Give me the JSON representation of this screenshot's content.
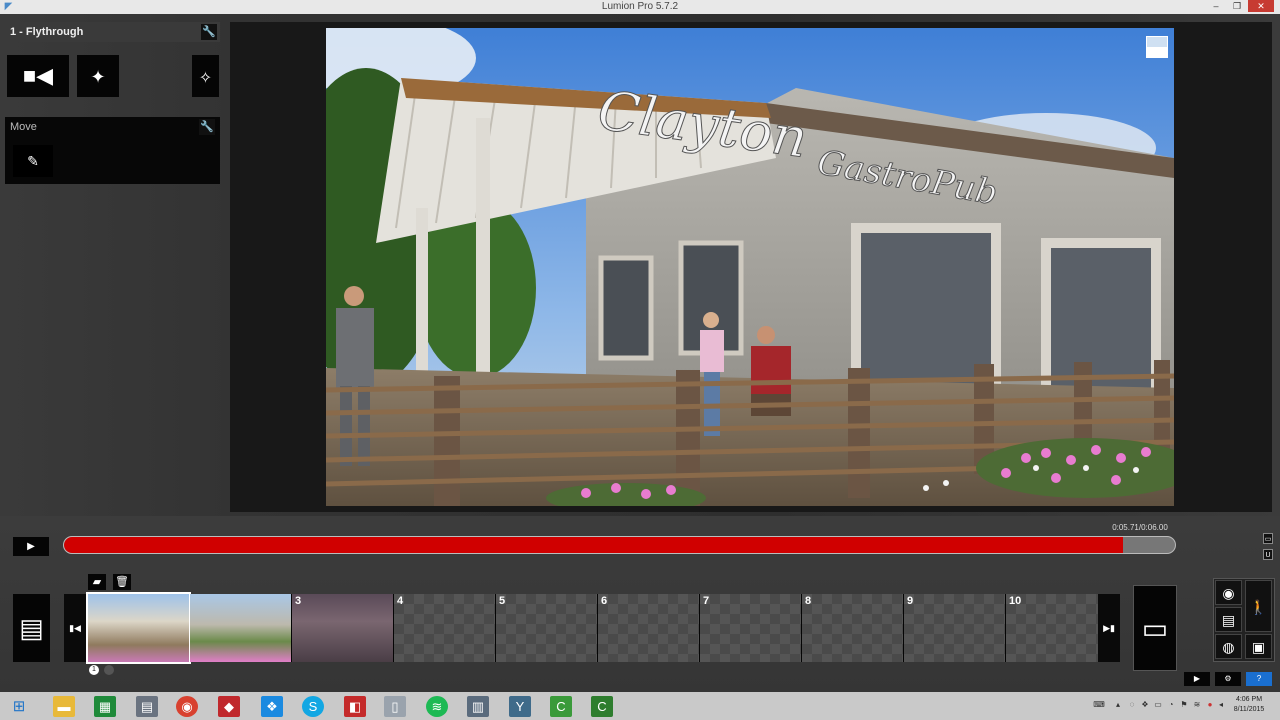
{
  "window": {
    "title": "Lumion Pro 5.7.2"
  },
  "panel": {
    "clip_title": "1 - Flythrough",
    "move_label": "Move"
  },
  "viewport": {
    "sign_line1": "Clayton",
    "sign_line2": "GastroPub"
  },
  "timeline": {
    "time_readout": "0:05.71/0:06.00",
    "progress": 0.953,
    "slots": [
      {
        "num": "",
        "filled": true,
        "scene": "pub-day"
      },
      {
        "num": "",
        "filled": true,
        "scene": "pub-wide"
      },
      {
        "num": "3",
        "filled": true,
        "scene": "pub-sign"
      },
      {
        "num": "4",
        "filled": false
      },
      {
        "num": "5",
        "filled": false
      },
      {
        "num": "6",
        "filled": false
      },
      {
        "num": "7",
        "filled": false
      },
      {
        "num": "8",
        "filled": false
      },
      {
        "num": "9",
        "filled": false
      },
      {
        "num": "10",
        "filled": false
      }
    ],
    "page_indicator": "1"
  },
  "icons": {
    "camera": "camera-icon",
    "effects": "sparkle-icon",
    "walk": "walker-icon",
    "film": "film-icon",
    "clapper": "clapperboard-icon"
  },
  "taskbar": {
    "time": "4:06 PM",
    "date": "8/11/2015",
    "help": "?"
  },
  "colors": {
    "progress_fill": "#d00000",
    "help_button": "#1a6fd0"
  }
}
